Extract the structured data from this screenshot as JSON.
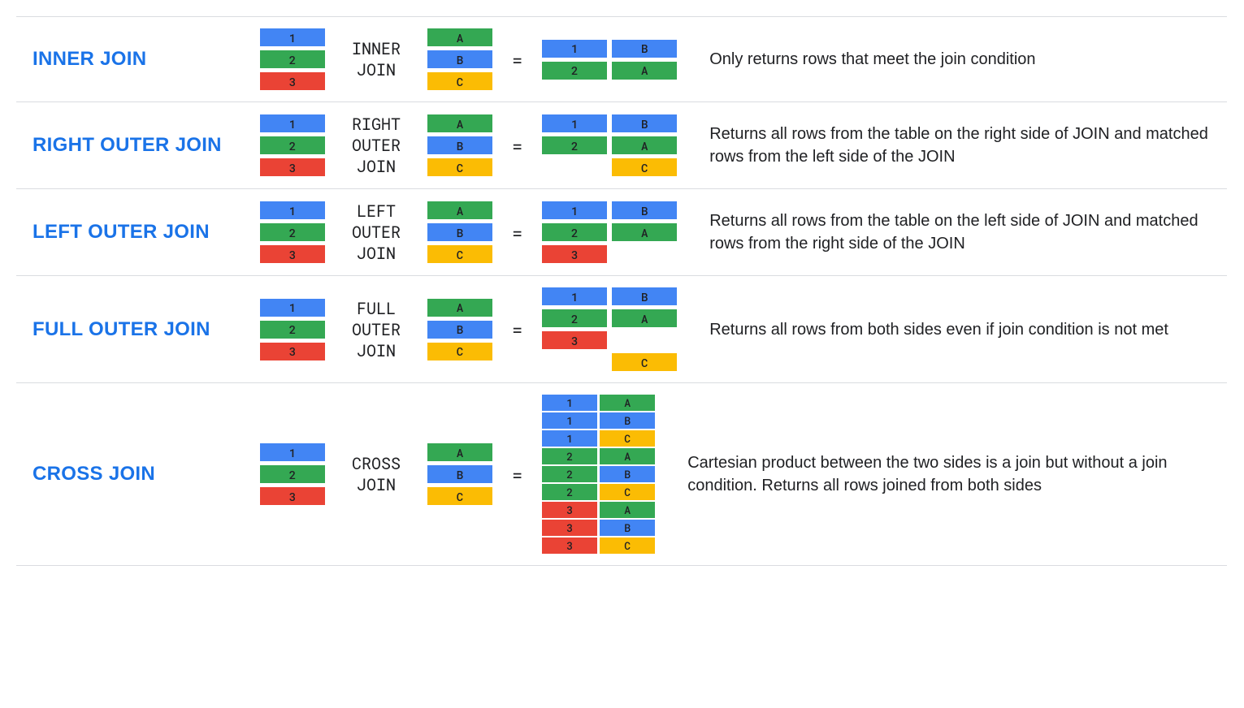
{
  "colors": {
    "blue": "#4285f4",
    "green": "#34a853",
    "red": "#ea4335",
    "yellow": "#fbbc04",
    "title": "#1a73e8"
  },
  "joins": [
    {
      "title": "INNER JOIN",
      "operator": "INNER\nJOIN",
      "left": [
        {
          "val": "1",
          "color": "blue"
        },
        {
          "val": "2",
          "color": "green"
        },
        {
          "val": "3",
          "color": "red"
        }
      ],
      "right": [
        {
          "val": "A",
          "color": "green"
        },
        {
          "val": "B",
          "color": "blue"
        },
        {
          "val": "C",
          "color": "yellow"
        }
      ],
      "result": [
        [
          {
            "val": "1",
            "color": "blue"
          },
          {
            "val": "B",
            "color": "blue"
          }
        ],
        [
          {
            "val": "2",
            "color": "green"
          },
          {
            "val": "A",
            "color": "green"
          }
        ]
      ],
      "description": "Only returns rows that meet the join condition"
    },
    {
      "title": "RIGHT OUTER JOIN",
      "operator": "RIGHT\nOUTER\nJOIN",
      "left": [
        {
          "val": "1",
          "color": "blue"
        },
        {
          "val": "2",
          "color": "green"
        },
        {
          "val": "3",
          "color": "red"
        }
      ],
      "right": [
        {
          "val": "A",
          "color": "green"
        },
        {
          "val": "B",
          "color": "blue"
        },
        {
          "val": "C",
          "color": "yellow"
        }
      ],
      "result": [
        [
          {
            "val": "1",
            "color": "blue"
          },
          {
            "val": "B",
            "color": "blue"
          }
        ],
        [
          {
            "val": "2",
            "color": "green"
          },
          {
            "val": "A",
            "color": "green"
          }
        ],
        [
          {
            "val": "",
            "color": "empty"
          },
          {
            "val": "C",
            "color": "yellow"
          }
        ]
      ],
      "description": "Returns all rows from the table on the right side of JOIN and matched rows from the left side of the JOIN"
    },
    {
      "title": "LEFT OUTER JOIN",
      "operator": "LEFT\nOUTER\nJOIN",
      "left": [
        {
          "val": "1",
          "color": "blue"
        },
        {
          "val": "2",
          "color": "green"
        },
        {
          "val": "3",
          "color": "red"
        }
      ],
      "right": [
        {
          "val": "A",
          "color": "green"
        },
        {
          "val": "B",
          "color": "blue"
        },
        {
          "val": "C",
          "color": "yellow"
        }
      ],
      "result": [
        [
          {
            "val": "1",
            "color": "blue"
          },
          {
            "val": "B",
            "color": "blue"
          }
        ],
        [
          {
            "val": "2",
            "color": "green"
          },
          {
            "val": "A",
            "color": "green"
          }
        ],
        [
          {
            "val": "3",
            "color": "red"
          },
          {
            "val": "",
            "color": "empty"
          }
        ]
      ],
      "description": "Returns all rows from the table on the left side of JOIN and matched rows from the right side of the JOIN"
    },
    {
      "title": "FULL OUTER JOIN",
      "operator": "FULL\nOUTER\nJOIN",
      "left": [
        {
          "val": "1",
          "color": "blue"
        },
        {
          "val": "2",
          "color": "green"
        },
        {
          "val": "3",
          "color": "red"
        }
      ],
      "right": [
        {
          "val": "A",
          "color": "green"
        },
        {
          "val": "B",
          "color": "blue"
        },
        {
          "val": "C",
          "color": "yellow"
        }
      ],
      "result": [
        [
          {
            "val": "1",
            "color": "blue"
          },
          {
            "val": "B",
            "color": "blue"
          }
        ],
        [
          {
            "val": "2",
            "color": "green"
          },
          {
            "val": "A",
            "color": "green"
          }
        ],
        [
          {
            "val": "3",
            "color": "red"
          },
          {
            "val": "",
            "color": "empty"
          }
        ],
        [
          {
            "val": "",
            "color": "empty"
          },
          {
            "val": "C",
            "color": "yellow"
          }
        ]
      ],
      "description": "Returns all rows from both sides even if join condition is not met"
    },
    {
      "title": "CROSS JOIN",
      "operator": "CROSS\nJOIN",
      "smallResult": true,
      "left": [
        {
          "val": "1",
          "color": "blue"
        },
        {
          "val": "2",
          "color": "green"
        },
        {
          "val": "3",
          "color": "red"
        }
      ],
      "right": [
        {
          "val": "A",
          "color": "green"
        },
        {
          "val": "B",
          "color": "blue"
        },
        {
          "val": "C",
          "color": "yellow"
        }
      ],
      "result": [
        [
          {
            "val": "1",
            "color": "blue"
          },
          {
            "val": "A",
            "color": "green"
          }
        ],
        [
          {
            "val": "1",
            "color": "blue"
          },
          {
            "val": "B",
            "color": "blue"
          }
        ],
        [
          {
            "val": "1",
            "color": "blue"
          },
          {
            "val": "C",
            "color": "yellow"
          }
        ],
        [
          {
            "val": "2",
            "color": "green"
          },
          {
            "val": "A",
            "color": "green"
          }
        ],
        [
          {
            "val": "2",
            "color": "green"
          },
          {
            "val": "B",
            "color": "blue"
          }
        ],
        [
          {
            "val": "2",
            "color": "green"
          },
          {
            "val": "C",
            "color": "yellow"
          }
        ],
        [
          {
            "val": "3",
            "color": "red"
          },
          {
            "val": "A",
            "color": "green"
          }
        ],
        [
          {
            "val": "3",
            "color": "red"
          },
          {
            "val": "B",
            "color": "blue"
          }
        ],
        [
          {
            "val": "3",
            "color": "red"
          },
          {
            "val": "C",
            "color": "yellow"
          }
        ]
      ],
      "description": "Cartesian product between the two sides is a join but without a join condition. Returns all rows joined from both sides"
    }
  ],
  "equals": "="
}
